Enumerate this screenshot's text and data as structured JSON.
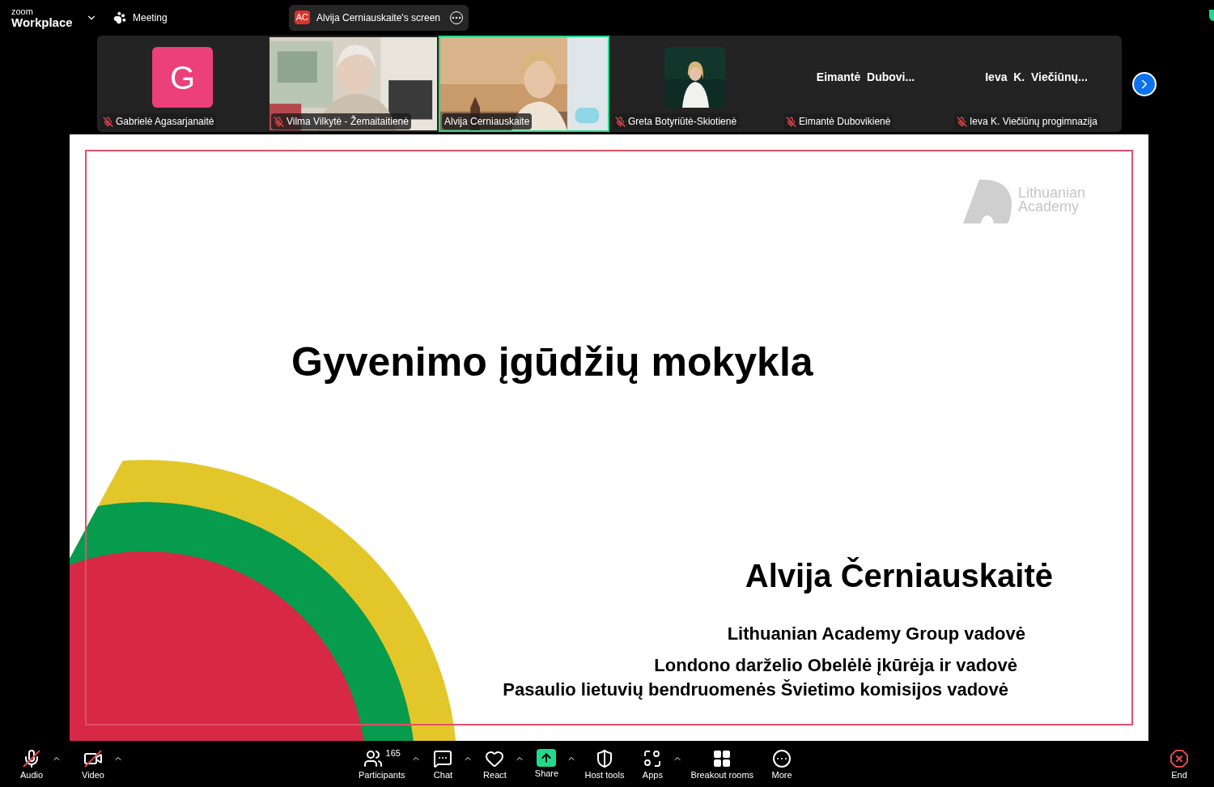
{
  "app": {
    "brand_top": "zoom",
    "brand_bottom": "Workplace"
  },
  "meeting": {
    "label": "Meeting"
  },
  "share_pill": {
    "initials": "AC",
    "label": "Alvija Cerniauskaite's screen"
  },
  "participants": [
    {
      "kind": "avatar",
      "letter": "G",
      "color": "#ec407a",
      "name": "Gabrielė Agasarjanaitė",
      "muted": true,
      "speaking": false
    },
    {
      "kind": "video",
      "name": "Vilma Vilkytė - Žemaitaitienė",
      "muted": true,
      "speaking": false
    },
    {
      "kind": "video",
      "name": "Alvija Cerniauskaite",
      "muted": false,
      "speaking": true
    },
    {
      "name": "Greta Botyriūtė-Skiotienė",
      "muted": true,
      "speaking": false
    },
    {
      "kind": "name",
      "display": "Eimantė  Dubovi...",
      "name": "Eimantė Dubovikienė",
      "muted": true,
      "speaking": false
    },
    {
      "kind": "name",
      "display": "Ieva  K.  Viečiūnų...",
      "name": "Ieva K. Viečiūnų progimnazija",
      "muted": true,
      "speaking": false
    }
  ],
  "slide": {
    "logo_line1": "Lithuanian",
    "logo_line2": "Academy",
    "title": "Gyvenimo įgūdžių mokykla",
    "author": "Alvija Černiauskaitė",
    "roles": [
      "Lithuanian Academy Group vadovė",
      "Londono darželio Obelėlė įkūrėja ir vadovė",
      "Pasaulio lietuvių bendruomenės Švietimo komisijos vadovė"
    ]
  },
  "toolbar": [
    {
      "kind": "audio",
      "label": "Audio",
      "off": true,
      "caret": true
    },
    {
      "kind": "video",
      "label": "Video",
      "off": true,
      "caret": true
    },
    {
      "kind": "participants",
      "label": "Participants",
      "count": "165",
      "caret": true
    },
    {
      "kind": "chat",
      "label": "Chat",
      "caret": true
    },
    {
      "kind": "react",
      "label": "React",
      "caret": true
    },
    {
      "kind": "share",
      "label": "Share",
      "caret": true
    },
    {
      "kind": "host",
      "label": "Host tools",
      "caret": false
    },
    {
      "kind": "apps",
      "label": "Apps",
      "caret": true
    },
    {
      "kind": "breakout",
      "label": "Breakout rooms",
      "caret": false
    },
    {
      "kind": "more",
      "label": "More",
      "caret": false
    },
    {
      "kind": "end",
      "label": "End",
      "caret": false
    }
  ]
}
